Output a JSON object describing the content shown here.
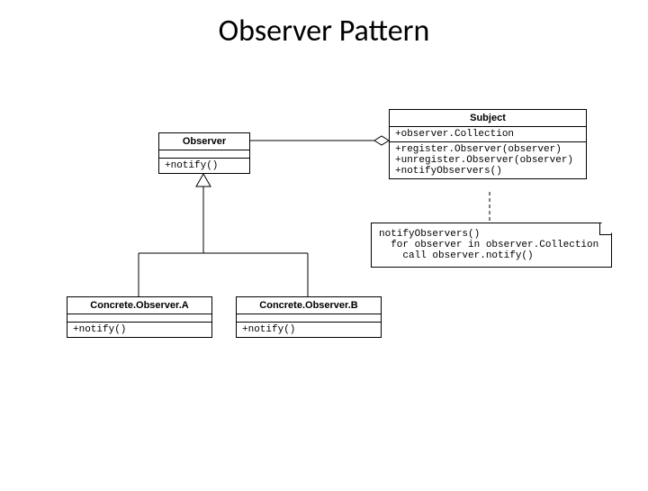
{
  "title": "Observer Pattern",
  "classes": {
    "observer": {
      "name": "Observer",
      "attrs": [],
      "ops": [
        "+notify()"
      ]
    },
    "subject": {
      "name": "Subject",
      "attrs": [
        "+observer.Collection"
      ],
      "ops": [
        "+register.Observer(observer)",
        "+unregister.Observer(observer)",
        "+notifyObservers()"
      ]
    },
    "concreteA": {
      "name": "Concrete.Observer.A",
      "attrs": [],
      "ops": [
        "+notify()"
      ]
    },
    "concreteB": {
      "name": "Concrete.Observer.B",
      "attrs": [],
      "ops": [
        "+notify()"
      ]
    }
  },
  "note_text": "notifyObservers()\n  for observer in observer.Collection\n    call observer.notify()"
}
